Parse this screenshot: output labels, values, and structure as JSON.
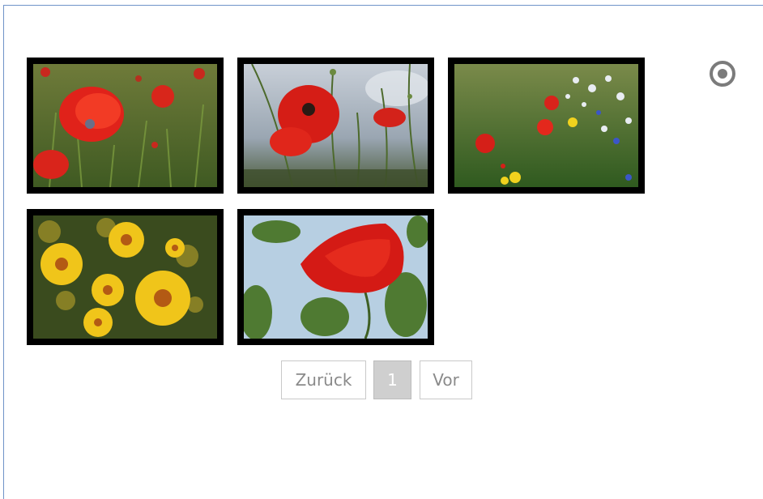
{
  "gallery": {
    "images": [
      {
        "name": "poppy-field"
      },
      {
        "name": "poppy-sky"
      },
      {
        "name": "wildflower-meadow"
      },
      {
        "name": "yellow-daisies"
      },
      {
        "name": "poppy-closeup"
      }
    ]
  },
  "pagination": {
    "prev_label": "Zurück",
    "current_page": "1",
    "next_label": "Vor"
  },
  "colors": {
    "frame_border": "#6f93c8",
    "thumb_border": "#000000",
    "current_page_bg": "#cfcfcf"
  },
  "icons": {
    "select": "radio-select-icon"
  }
}
